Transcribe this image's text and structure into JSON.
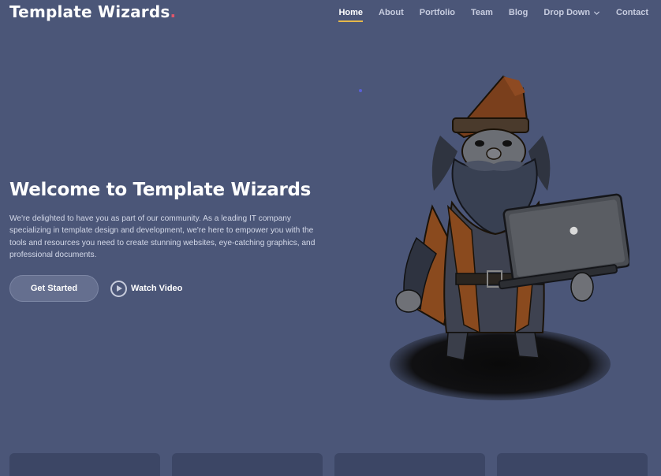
{
  "brand": {
    "name": "Template Wizards",
    "dot": ".",
    "accent": "#e0566b"
  },
  "nav": {
    "items": [
      {
        "label": "Home",
        "active": true
      },
      {
        "label": "About"
      },
      {
        "label": "Portfolio"
      },
      {
        "label": "Team"
      },
      {
        "label": "Blog"
      },
      {
        "label": "Drop Down",
        "dropdown": true
      },
      {
        "label": "Contact"
      }
    ],
    "active_underline": "#e6b84a"
  },
  "hero": {
    "title": "Welcome to Template Wizards",
    "text": "We're delighted to have you as part of our community. As a leading IT company specializing in template design and development, we're here to empower you with the tools and resources you need to create stunning websites, eye-catching graphics, and professional documents.",
    "cta_label": "Get Started",
    "video_label": "Watch Video"
  },
  "colors": {
    "background": "#4b5678",
    "card": "#3c4665"
  }
}
